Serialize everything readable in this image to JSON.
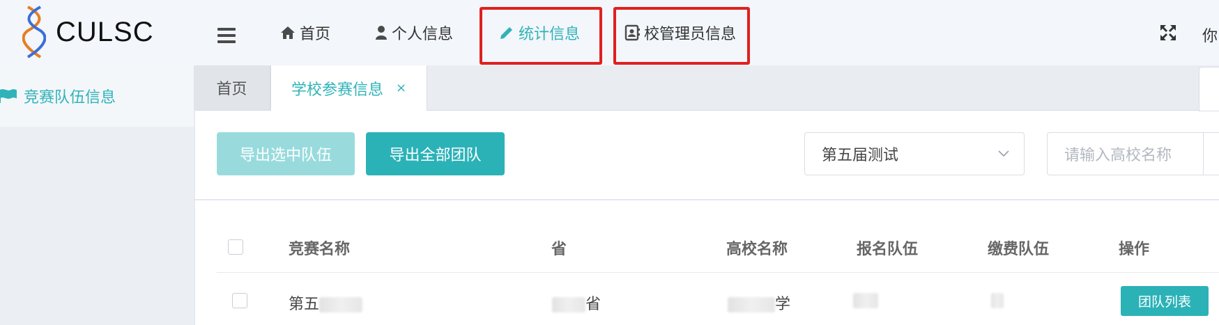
{
  "header": {
    "brand": "CULSC",
    "nav": [
      {
        "label": "首页",
        "icon": "home-icon"
      },
      {
        "label": "个人信息",
        "icon": "user-icon"
      },
      {
        "label": "统计信息",
        "icon": "pencil-icon"
      },
      {
        "label": "校管理员信息",
        "icon": "contact-card-icon"
      }
    ],
    "greeting": "你"
  },
  "sidebar": {
    "items": [
      {
        "label": "竞赛队伍信息",
        "icon": "flag-icon"
      }
    ]
  },
  "tabs": {
    "home_label": "首页",
    "current_label": "学校参赛信息",
    "close": "×"
  },
  "toolbar": {
    "export_selected": "导出选中队伍",
    "export_all": "导出全部团队",
    "competition_select": "第五届测试",
    "school_placeholder": "请输入高校名称"
  },
  "table": {
    "columns": [
      "竞赛名称",
      "省",
      "高校名称",
      "报名队伍",
      "缴费队伍",
      "操作"
    ],
    "rows": [
      {
        "competition_prefix": "第五",
        "province_suffix": "省",
        "school_suffix": "学",
        "action": "团队列表"
      }
    ]
  },
  "colors": {
    "accent": "#2fb3b8",
    "highlight_border": "#e02020",
    "button_primary": "#2bb2b7",
    "button_disabled": "#99dbdd"
  }
}
